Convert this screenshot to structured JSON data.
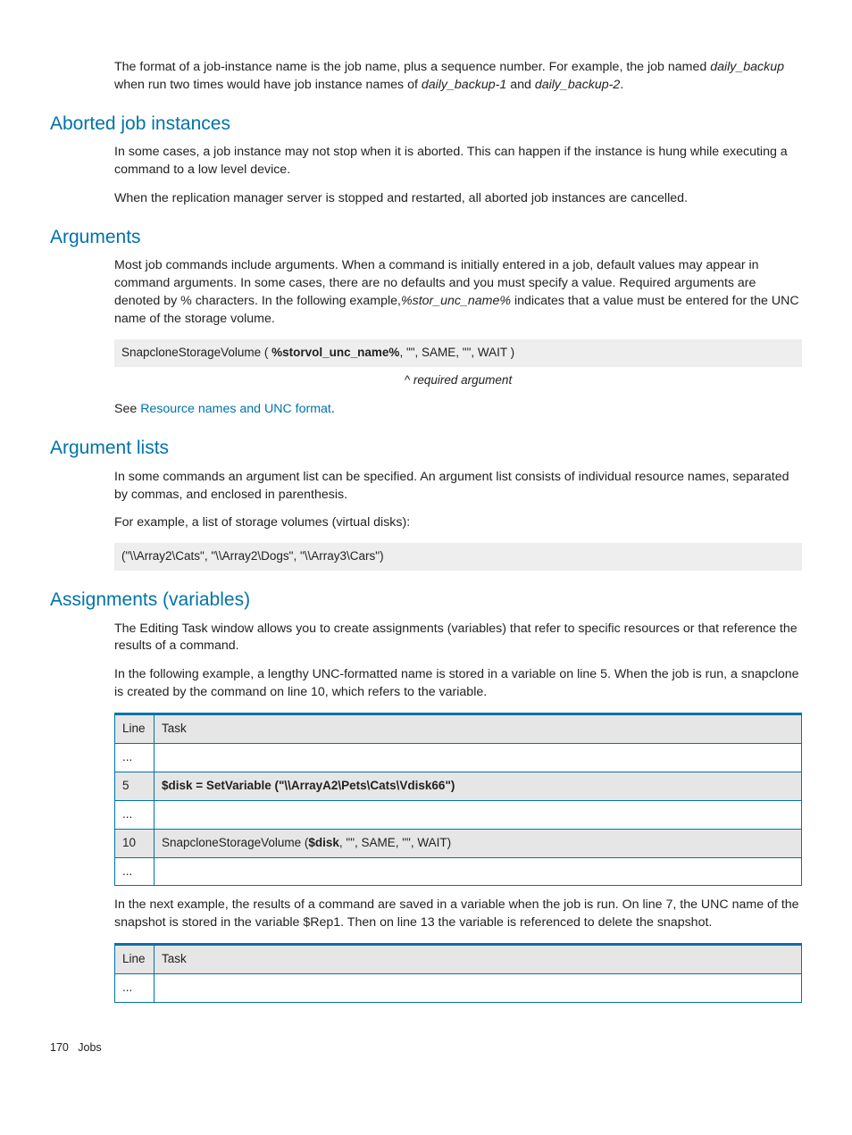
{
  "intro": {
    "p1_a": "The format of a job-instance name is the job name, plus a sequence number. For example, the job named ",
    "p1_i1": "daily_backup",
    "p1_b": " when run two times would have job instance names of ",
    "p1_i2": "daily_backup-1",
    "p1_c": " and ",
    "p1_i3": "daily_backup-2",
    "p1_d": "."
  },
  "sec_aborted": {
    "title": "Aborted job instances",
    "p1": "In some cases, a job instance may not stop when it is aborted. This can happen if the instance is hung while executing a command to a low level device.",
    "p2": "When the replication manager server is stopped and restarted, all aborted job instances are cancelled."
  },
  "sec_arguments": {
    "title": "Arguments",
    "p1_a": "Most job commands include arguments. When a command is initially entered in a job, default values may appear in command arguments. In some cases, there are no defaults and you must specify a value. Required arguments are denoted by % characters. In the following example,",
    "p1_i1": "%stor_unc_name%",
    "p1_b": " indicates that a value must be entered for the UNC name of the storage volume.",
    "code_a": "SnapcloneStorageVolume ( ",
    "code_b": "%storvol_unc_name%",
    "code_c": ", \"\", SAME, \"\", WAIT )",
    "caption": "^ required argument",
    "see": "See ",
    "link": "Resource names and UNC format",
    "dot": "."
  },
  "sec_arglists": {
    "title": "Argument lists",
    "p1": "In some commands an argument list can be specified. An argument list consists of individual resource names, separated by commas, and enclosed in parenthesis.",
    "p2": "For example, a list of storage volumes (virtual disks):",
    "code": "(\"\\\\Array2\\Cats\", \"\\\\Array2\\Dogs\", \"\\\\Array3\\Cars\")"
  },
  "sec_assign": {
    "title": "Assignments (variables)",
    "p1": "The Editing Task window allows you to create assignments (variables) that refer to specific resources or that reference the results of a command.",
    "p2": "In the following example, a lengthy UNC-formatted name is stored in a variable on line 5. When the job is run, a snapclone is created by the command on line 10, which refers to the variable.",
    "table1": {
      "h1": "Line",
      "h2": "Task",
      "r1c1": "...",
      "r1c2": "",
      "r2c1": "5",
      "r2c2a": "$disk = SetVariable (\"\\\\ArrayA2\\Pets\\Cats\\Vdisk66\")",
      "r3c1": "...",
      "r3c2": "",
      "r4c1": "10",
      "r4c2a": "SnapcloneStorageVolume (",
      "r4c2b": "$disk",
      "r4c2c": ", \"\", SAME, \"\", WAIT)",
      "r5c1": "...",
      "r5c2": ""
    },
    "p3": "In the next example, the results of a command are saved in a variable when the job is run. On line 7, the UNC name of the snapshot is stored in the variable $Rep1. Then on line 13 the variable is referenced to delete the snapshot.",
    "table2": {
      "h1": "Line",
      "h2": "Task",
      "r1c1": "...",
      "r1c2": ""
    }
  },
  "footer": {
    "page": "170",
    "section": "Jobs"
  }
}
